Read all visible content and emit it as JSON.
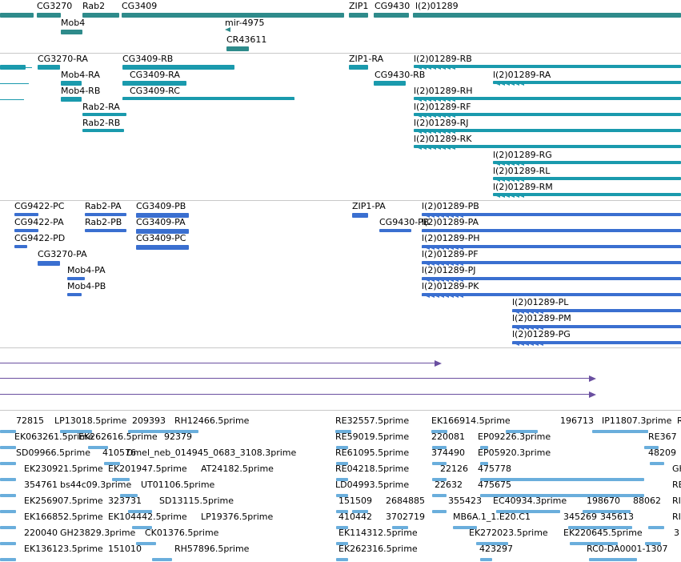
{
  "colors": {
    "gene_track": "#2e8b8b",
    "transcript_track": "#1a9aad",
    "protein_track": "#3a6fd0",
    "purple_track": "#6a4fa0",
    "est_track": "#6aaedc",
    "separator": "#c8c8c8"
  },
  "tracks": {
    "genes": {
      "color": "#2e8b8b",
      "labels": [
        "CG3270",
        "Rab2",
        "CG3409",
        "ZIP1",
        "CG9430",
        "l(2)01289",
        "Mob4",
        "mir-4975",
        "CR43611"
      ]
    },
    "transcripts": {
      "color": "#1a9aad",
      "labels": [
        "CG3270-RA",
        "CG3409-RB",
        "ZIP1-RA",
        "l(2)01289-RB",
        "Mob4-RA",
        "CG3409-RA",
        "CG9430-RB",
        "l(2)01289-RA",
        "Mob4-RB",
        "CG3409-RC",
        "l(2)01289-RH",
        "Rab2-RA",
        "l(2)01289-RF",
        "Rab2-RB",
        "l(2)01289-RJ",
        "l(2)01289-RK",
        "l(2)01289-RG",
        "l(2)01289-RL",
        "l(2)01289-RM"
      ]
    },
    "proteins": {
      "color": "#3a6fd0",
      "labels": [
        "CG9422-PC",
        "Rab2-PA",
        "CG3409-PB",
        "ZIP1-PA",
        "l(2)01289-PB",
        "CG9422-PA",
        "Rab2-PB",
        "CG3409-PA",
        "CG9430-PB",
        "l(2)01289-PA",
        "CG9422-PD",
        "CG3409-PC",
        "l(2)01289-PH",
        "CG3270-PA",
        "l(2)01289-PF",
        "Mob4-PA",
        "l(2)01289-PJ",
        "Mob4-PB",
        "l(2)01289-PK",
        "l(2)01289-PL",
        "l(2)01289-PM",
        "l(2)01289-PG"
      ]
    },
    "ests": {
      "color": "#6aaedc",
      "labels": [
        "72815",
        "LP13018.5prime",
        "209393",
        "RH12466.5prime",
        "RE32557.5prime",
        "EK166914.5prime",
        "196713",
        "IP11807.3prime",
        "R",
        "EK063261.5prime",
        "EK262616.5prime",
        "92379",
        "RE59019.5prime",
        "220081",
        "EP09226.3prime",
        "RE367",
        "SD09966.5prime",
        "410576",
        "Dmel_neb_014945_0683_3108.3prime",
        "RE61095.5prime",
        "374490",
        "EP05920.3prime",
        "48209",
        "EK230921.5prime",
        "EK201947.5prime",
        "AT24182.5prime",
        "RE04218.5prime",
        "22126",
        "475778",
        "GH",
        "354761",
        "bs44c09.3prime",
        "UT01106.5prime",
        "LD04993.5prime",
        "22632",
        "475675",
        "RE",
        "EK256907.5prime",
        "323731",
        "SD13115.5prime",
        "151509",
        "2684885",
        "355423",
        "EC40934.3prime",
        "198670",
        "88062",
        "RI",
        "EK166852.5prime",
        "EK104442.5prime",
        "LP19376.5prime",
        "410442",
        "3702719",
        "MB6A.1_1.E20.C1",
        "345269",
        "345613",
        "RI",
        "220040",
        "GH23829.3prime",
        "CK01376.5prime",
        "EK114312.5prime",
        "EK272023.5prime",
        "EK220645.5prime",
        "3",
        "EK136123.5prime",
        "151010",
        "RH57896.5prime",
        "EK262316.5prime",
        "423297",
        "RC0-DA0001-1307"
      ]
    }
  }
}
